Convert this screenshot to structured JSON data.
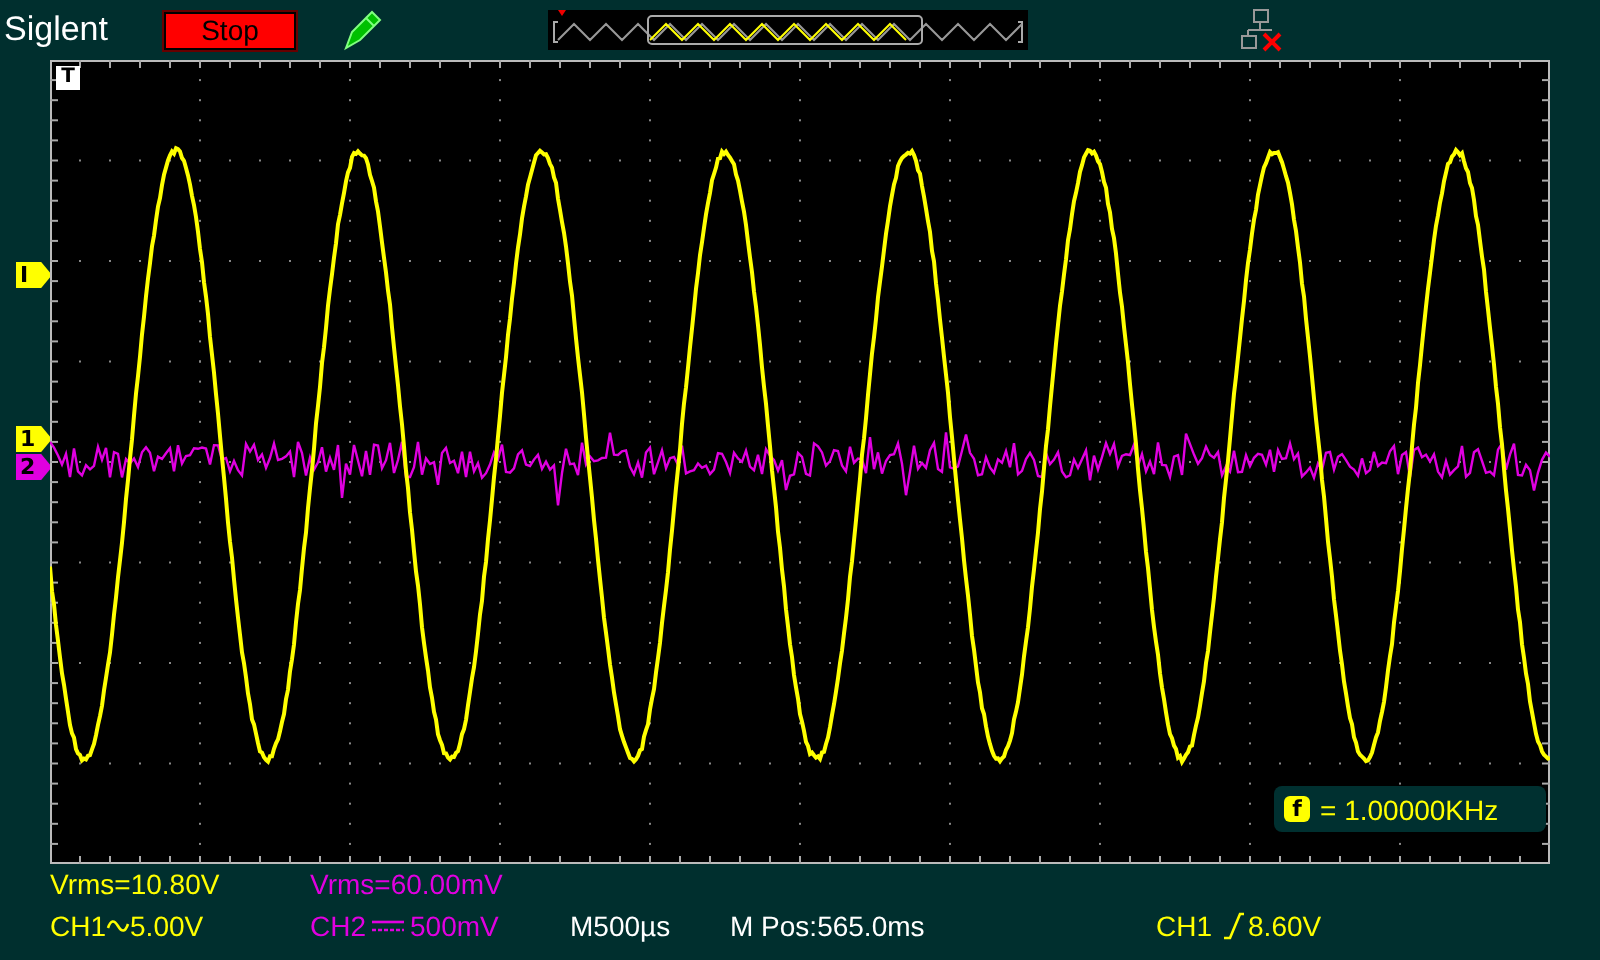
{
  "brand": "Siglent",
  "run_button": {
    "label": "Stop",
    "running": false
  },
  "trigger_position_marker": "T",
  "trigger_level_marker": "I",
  "channels": [
    {
      "name": "CH1",
      "color": "#ffff00",
      "marker": "1",
      "ac_coupled": true,
      "scale": "5.00V",
      "measurement": "Vrms=10.80V"
    },
    {
      "name": "CH2",
      "color": "#e000e0",
      "marker": "2",
      "ac_coupled": false,
      "scale": "500mV",
      "measurement": "Vrms=60.00mV"
    }
  ],
  "frequency_readout": {
    "icon_letter": "f",
    "value": "= 1.00000KHz"
  },
  "timebase": "M500µs",
  "position": "M Pos:565.0ms",
  "trigger": {
    "source": "CH1",
    "rising_edge": true,
    "level": "8.60V"
  }
}
